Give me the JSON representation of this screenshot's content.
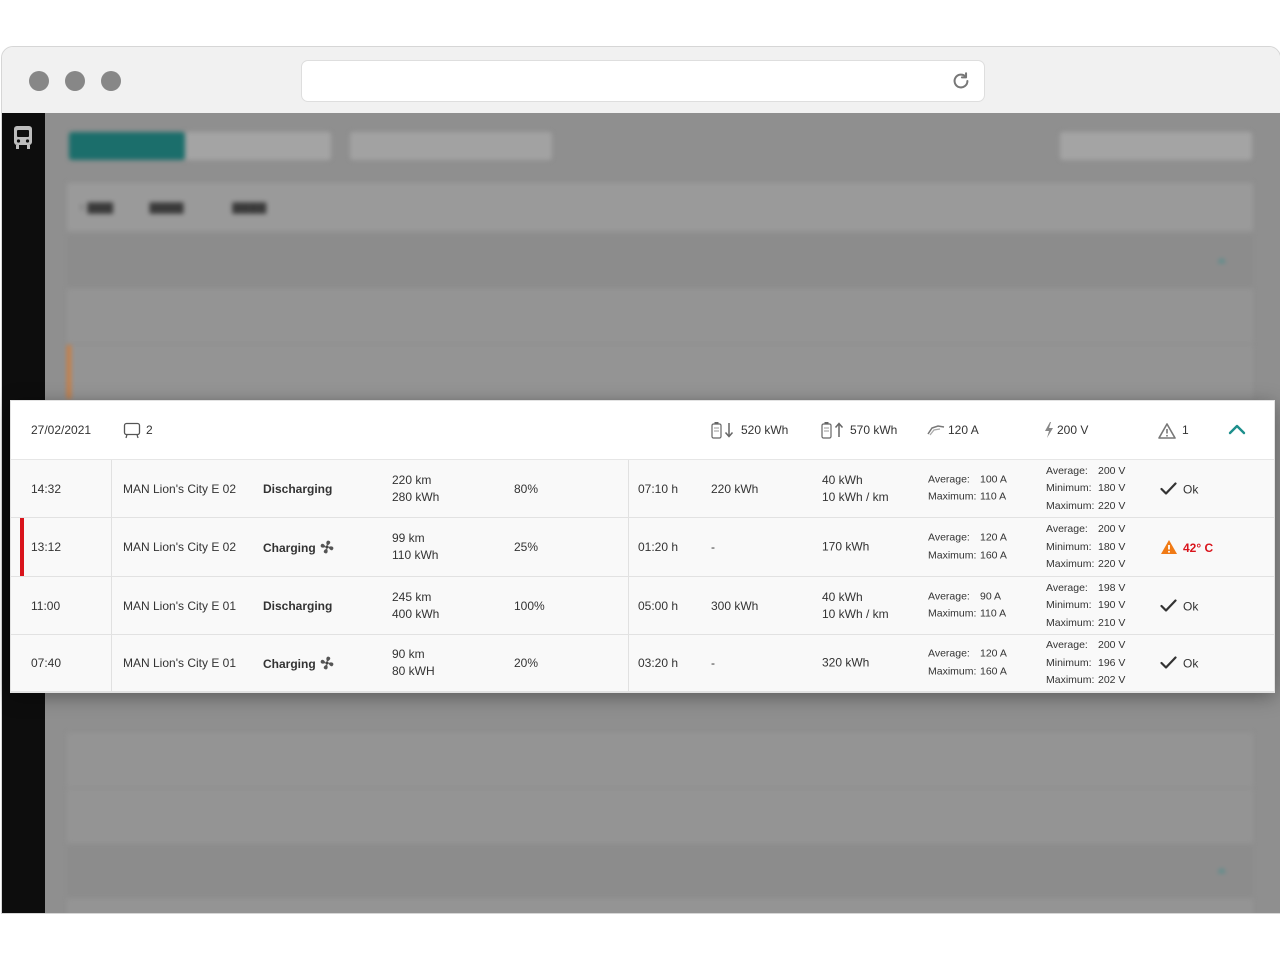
{
  "group": {
    "date": "27/02/2021",
    "vehicle_count": "2",
    "energy_out": "520 kWh",
    "energy_in": "570 kWh",
    "current": "120 A",
    "voltage": "200 V",
    "warnings": "1"
  },
  "rows": [
    {
      "time": "14:32",
      "vehicle": "MAN Lion's City E 02",
      "status": "Discharging",
      "remaining_km": "220 km",
      "remaining_kwh": "280 kWh",
      "soc": "80%",
      "duration": "07:10 h",
      "energy_out": "220 kWh",
      "energy_in_1": "40 kWh",
      "energy_in_2": "10 kWh / km",
      "cur_avg_label": "Average:",
      "cur_avg": "100 A",
      "cur_max_label": "Maximum:",
      "cur_max": "110 A",
      "v_avg_label": "Average:",
      "v_avg": "200 V",
      "v_min_label": "Minimum:",
      "v_min": "180 V",
      "v_max_label": "Maximum:",
      "v_max": "220 V",
      "temp": "Ok"
    },
    {
      "time": "13:12",
      "vehicle": "MAN Lion's City E 02",
      "status": "Charging",
      "remaining_km": "99 km",
      "remaining_kwh": "110 kWh",
      "soc": "25%",
      "duration": "01:20 h",
      "energy_out": "-",
      "energy_in_1": "170 kWh",
      "energy_in_2": "",
      "cur_avg_label": "Average:",
      "cur_avg": "120 A",
      "cur_max_label": "Maximum:",
      "cur_max": "160 A",
      "v_avg_label": "Average:",
      "v_avg": "200 V",
      "v_min_label": "Minimum:",
      "v_min": "180 V",
      "v_max_label": "Maximum:",
      "v_max": "220 V",
      "temp": "42° C"
    },
    {
      "time": "11:00",
      "vehicle": "MAN Lion's City E 01",
      "status": "Discharging",
      "remaining_km": "245 km",
      "remaining_kwh": "400 kWh",
      "soc": "100%",
      "duration": "05:00 h",
      "energy_out": "300 kWh",
      "energy_in_1": "40 kWh",
      "energy_in_2": "10 kWh / km",
      "cur_avg_label": "Average:",
      "cur_avg": "90 A",
      "cur_max_label": "Maximum:",
      "cur_max": "110 A",
      "v_avg_label": "Average:",
      "v_avg": "198 V",
      "v_min_label": "Minimum:",
      "v_min": "190 V",
      "v_max_label": "Maximum:",
      "v_max": "210 V",
      "temp": "Ok"
    },
    {
      "time": "07:40",
      "vehicle": "MAN Lion's City E 01",
      "status": "Charging",
      "remaining_km": "90 km",
      "remaining_kwh": "80 kWH",
      "soc": "20%",
      "duration": "03:20 h",
      "energy_out": "-",
      "energy_in_1": "320 kWh",
      "energy_in_2": "",
      "cur_avg_label": "Average:",
      "cur_avg": "120 A",
      "cur_max_label": "Maximum:",
      "cur_max": "160 A",
      "v_avg_label": "Average:",
      "v_avg": "200 V",
      "v_min_label": "Minimum:",
      "v_min": "196 V",
      "v_max_label": "Maximum:",
      "v_max": "202 V",
      "temp": "Ok"
    }
  ],
  "colors": {
    "accent": "#1d8f8c",
    "warning": "#d9141c",
    "warning_icon": "#f07a15",
    "sidebar": "#0d0d0d"
  },
  "icons": {
    "bus": "bus-icon",
    "battery_out": "battery-discharge-icon",
    "battery_in": "battery-charge-icon",
    "current": "current-icon",
    "voltage": "lightning-icon",
    "warning": "warning-icon",
    "collapse": "chevron-up-icon",
    "check": "check-icon",
    "fan": "fan-icon",
    "reload": "reload-icon"
  }
}
